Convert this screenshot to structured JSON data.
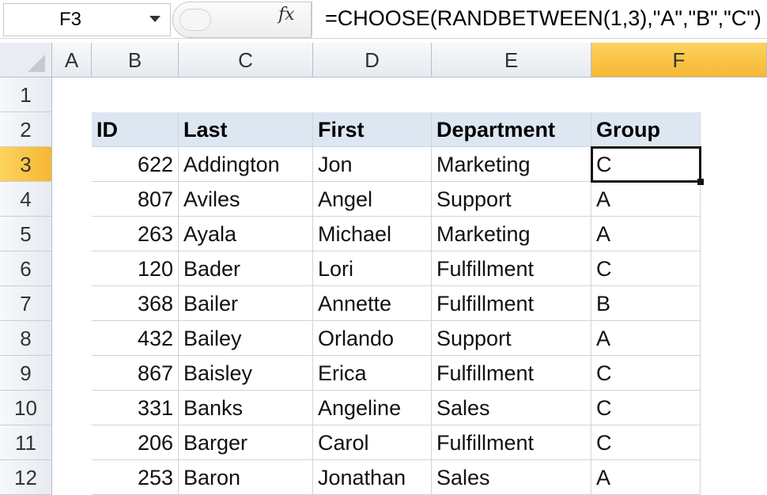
{
  "formula_bar": {
    "name_box": "F3",
    "fx_label": "fx",
    "formula": "=CHOOSE(RANDBETWEEN(1,3),\"A\",\"B\",\"C\")"
  },
  "columns": [
    "A",
    "B",
    "C",
    "D",
    "E",
    "F"
  ],
  "selected_column": "F",
  "rows": [
    "1",
    "2",
    "3",
    "4",
    "5",
    "6",
    "7",
    "8",
    "9",
    "10",
    "11",
    "12"
  ],
  "selected_row": "3",
  "table": {
    "headers": [
      "ID",
      "Last",
      "First",
      "Department",
      "Group"
    ],
    "records": [
      [
        "622",
        "Addington",
        "Jon",
        "Marketing",
        "C"
      ],
      [
        "807",
        "Aviles",
        "Angel",
        "Support",
        "A"
      ],
      [
        "263",
        "Ayala",
        "Michael",
        "Marketing",
        "A"
      ],
      [
        "120",
        "Bader",
        "Lori",
        "Fulfillment",
        "C"
      ],
      [
        "368",
        "Bailer",
        "Annette",
        "Fulfillment",
        "B"
      ],
      [
        "432",
        "Bailey",
        "Orlando",
        "Support",
        "A"
      ],
      [
        "867",
        "Baisley",
        "Erica",
        "Fulfillment",
        "C"
      ],
      [
        "331",
        "Banks",
        "Angeline",
        "Sales",
        "C"
      ],
      [
        "206",
        "Barger",
        "Carol",
        "Fulfillment",
        "C"
      ],
      [
        "253",
        "Baron",
        "Jonathan",
        "Sales",
        "A"
      ]
    ]
  },
  "colors": {
    "selected_header": "#f7b733",
    "table_header_fill": "#dde7f1",
    "grid_line": "#cfd5dc"
  }
}
